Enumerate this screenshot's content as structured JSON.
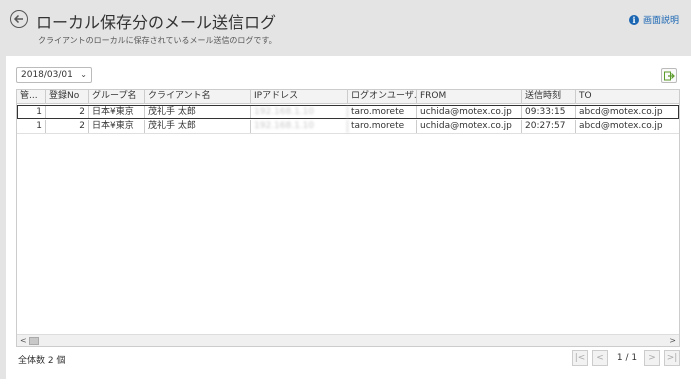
{
  "header": {
    "title": "ローカル保存分のメール送信ログ",
    "subtitle": "クライアントのローカルに保存されているメール送信のログです。",
    "help_label": "画面説明",
    "help_icon": "info-icon",
    "back_icon": "back-arrow-icon"
  },
  "filter": {
    "date_selected": "2018/03/01",
    "export_icon": "export-icon"
  },
  "table": {
    "columns": [
      "管...",
      "登録No",
      "グループ名",
      "クライアント名",
      "IPアドレス",
      "ログオンユーザ...",
      "FROM",
      "送信時刻",
      "TO"
    ],
    "rows": [
      {
        "kan": "1",
        "reg_no": "2",
        "group": "日本¥東京",
        "client": "茂礼手 太郎",
        "ip": "192.168.1.10",
        "logon_user": "taro.morete",
        "from": "uchida@motex.co.jp",
        "time": "09:33:15",
        "to": "abcd@motex.co.jp"
      },
      {
        "kan": "1",
        "reg_no": "2",
        "group": "日本¥東京",
        "client": "茂礼手 太郎",
        "ip": "192.168.1.10",
        "logon_user": "taro.morete",
        "from": "uchida@motex.co.jp",
        "time": "20:27:57",
        "to": "abcd@motex.co.jp"
      }
    ]
  },
  "footer": {
    "total_label": "全体数 2 個",
    "page_info": "1 / 1"
  }
}
